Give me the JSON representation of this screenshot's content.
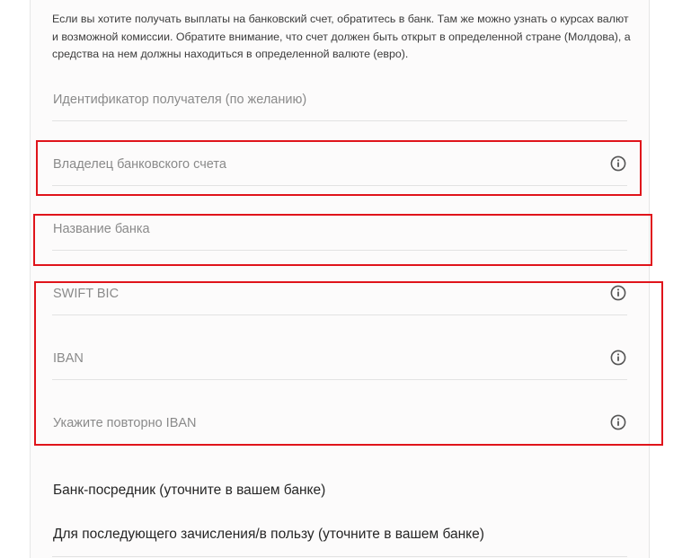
{
  "info": {
    "text": "Если вы хотите получать выплаты на банковский счет, обратитесь в банк. Там же можно узнать о курсах валют и возможной комиссии. Обратите внимание, что счет должен быть открыт в определенной стране (Молдова), а средства на нем должны находиться в определенной валюте (евро)."
  },
  "fields": {
    "recipient_id": "Идентификатор получателя (по желанию)",
    "account_holder": "Владелец банковского счета",
    "bank_name": "Название банка",
    "swift_bic": "SWIFT BIC",
    "iban": "IBAN",
    "iban_repeat": "Укажите повторно IBAN",
    "intermediary_bank": "Банк-посредник (уточните в вашем банке)",
    "further_credit": "Для последующего зачисления/в пользу (уточните в вашем банке)"
  },
  "icons": {
    "info": "info-circle-icon"
  },
  "colors": {
    "highlight": "#e0141b",
    "placeholder": "#8a8a8a",
    "label_dark": "#262626",
    "icon": "#555555"
  }
}
